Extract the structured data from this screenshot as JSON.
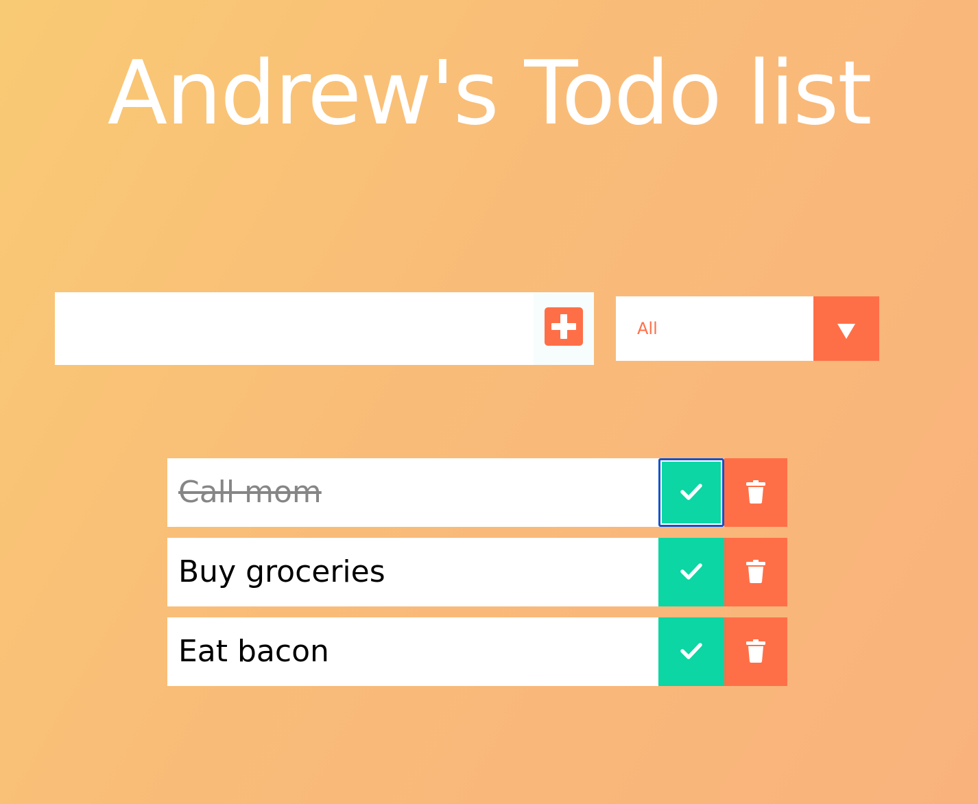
{
  "header": {
    "title": "Andrew's Todo list"
  },
  "form": {
    "input_value": "",
    "input_placeholder": "",
    "add_icon": "plus-icon",
    "filter_selected": "All",
    "filter_arrow_icon": "caret-down-icon"
  },
  "todos": [
    {
      "text": "Call mom",
      "completed": true
    },
    {
      "text": "Buy groceries",
      "completed": false
    },
    {
      "text": "Eat bacon",
      "completed": false
    }
  ],
  "icons": {
    "complete": "check-icon",
    "delete": "trash-icon"
  },
  "colors": {
    "accent": "#ff6f47",
    "complete": "#0bd6a4",
    "gradient_start": "#f9ca74",
    "gradient_end": "#f9b27c",
    "focus_ring": "#1053cc"
  }
}
